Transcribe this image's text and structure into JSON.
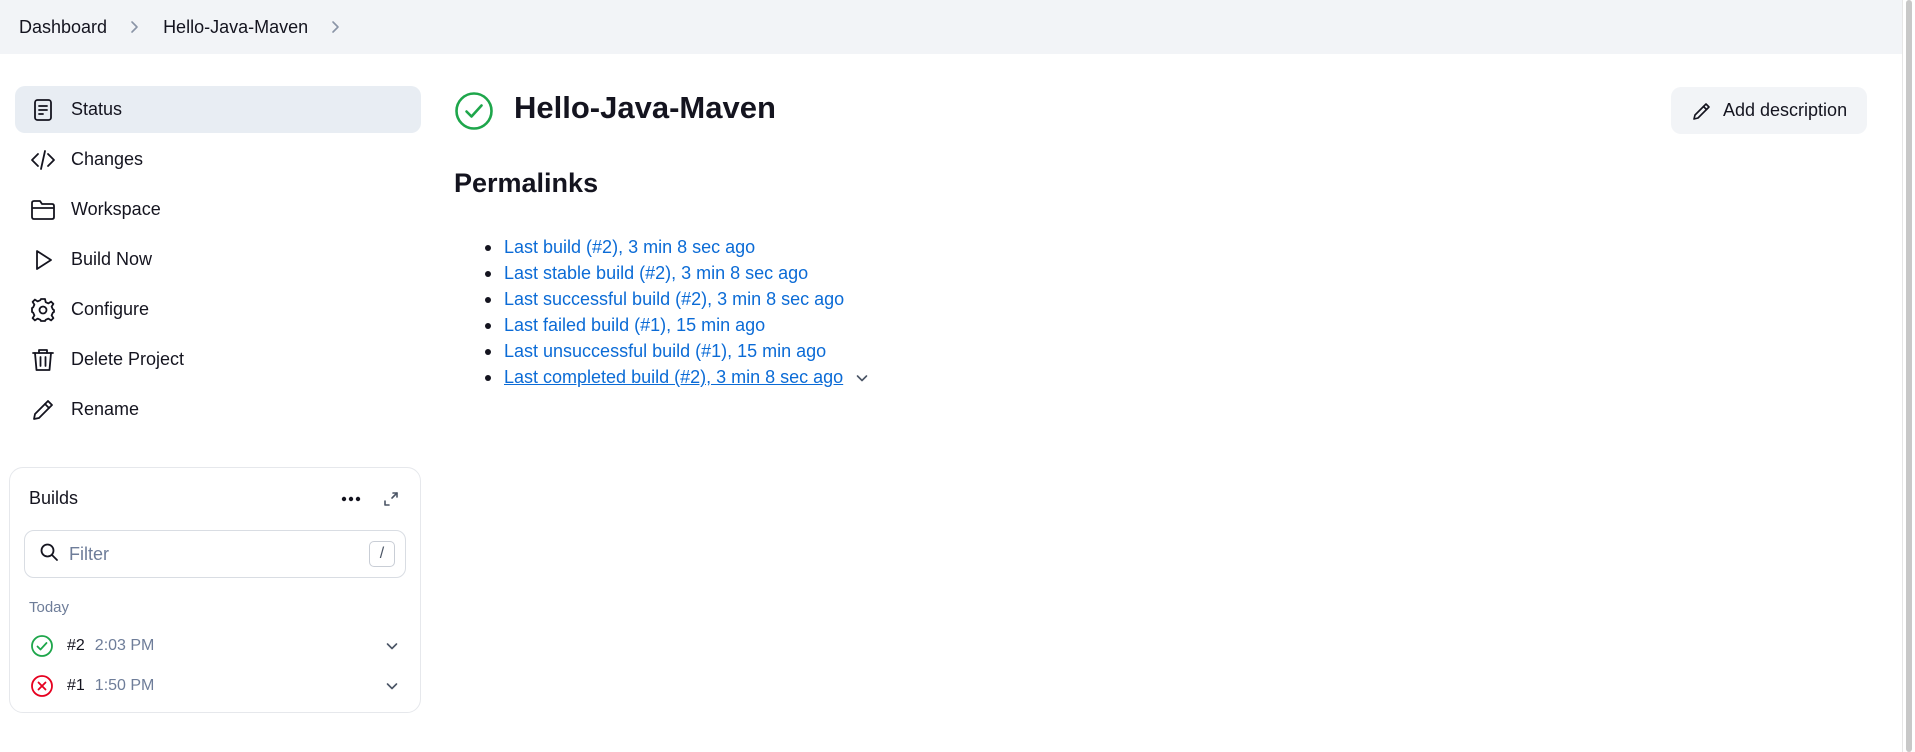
{
  "breadcrumb": {
    "items": [
      {
        "label": "Dashboard"
      },
      {
        "label": "Hello-Java-Maven"
      }
    ]
  },
  "sidebar": {
    "items": [
      {
        "label": "Status",
        "icon": "status-document-icon",
        "active": true
      },
      {
        "label": "Changes",
        "icon": "code-icon"
      },
      {
        "label": "Workspace",
        "icon": "folder-icon"
      },
      {
        "label": "Build Now",
        "icon": "play-icon"
      },
      {
        "label": "Configure",
        "icon": "gear-icon"
      },
      {
        "label": "Delete Project",
        "icon": "trash-icon"
      },
      {
        "label": "Rename",
        "icon": "pencil-icon"
      }
    ]
  },
  "builds": {
    "title": "Builds",
    "filter_placeholder": "Filter",
    "shortcut_key": "/",
    "day_label": "Today",
    "items": [
      {
        "number": "#2",
        "time": "2:03 PM",
        "status": "success"
      },
      {
        "number": "#1",
        "time": "1:50 PM",
        "status": "failed"
      }
    ]
  },
  "main": {
    "title": "Hello-Java-Maven",
    "status": "success",
    "add_description_label": "Add description",
    "permalinks_title": "Permalinks",
    "permalinks": [
      "Last build (#2), 3 min 8 sec ago",
      "Last stable build (#2), 3 min 8 sec ago",
      "Last successful build (#2), 3 min 8 sec ago",
      "Last failed build (#1), 15 min ago",
      "Last unsuccessful build (#1), 15 min ago",
      "Last completed build (#2), 3 min 8 sec ago"
    ]
  },
  "colors": {
    "success": "#1ea64b",
    "failed": "#e6001f",
    "link": "#0b6bd6",
    "active_bg": "#e8edf3",
    "muted": "#6e7d99"
  }
}
